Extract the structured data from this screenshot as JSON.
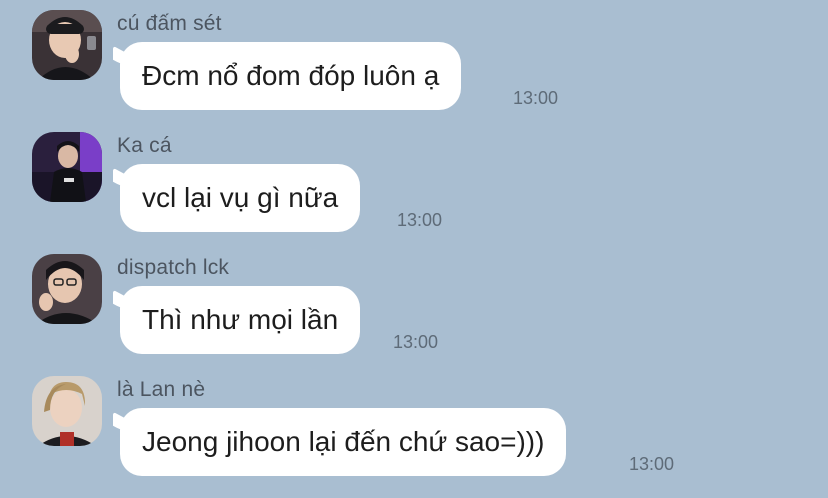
{
  "chat": {
    "messages": [
      {
        "sender": "cú đấm sét",
        "text": "Đcm nổ đom đóp luôn ạ",
        "time": "13:00",
        "avatar_icon": "user-avatar-icon"
      },
      {
        "sender": "Ka cá",
        "text": "vcl lại vụ gì nữa",
        "time": "13:00",
        "avatar_icon": "user-avatar-icon"
      },
      {
        "sender": "dispatch lck",
        "text": "Thì như mọi lần",
        "time": "13:00",
        "avatar_icon": "user-avatar-icon"
      },
      {
        "sender": "là Lan nè",
        "text": "Jeong jihoon lại đến chứ sao=)))",
        "time": "13:00",
        "avatar_icon": "user-avatar-icon"
      }
    ]
  },
  "colors": {
    "background": "#a9bed1",
    "bubble": "#ffffff",
    "sender_text": "#4c5560",
    "time_text": "#5e6b78"
  }
}
